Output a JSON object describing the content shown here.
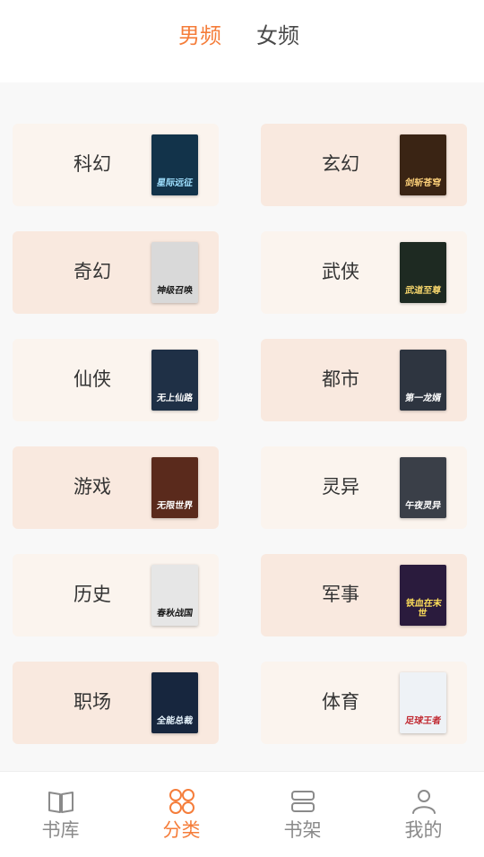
{
  "tabs": {
    "active": "男频",
    "inactive": "女频"
  },
  "categories": [
    {
      "label": "科幻",
      "cover_text": "星际远征",
      "cover_bg": "#12334a",
      "cover_fg": "#9fe0ff"
    },
    {
      "label": "玄幻",
      "cover_text": "剑斩苍穹",
      "cover_bg": "#3a2414",
      "cover_fg": "#ffd27a"
    },
    {
      "label": "奇幻",
      "cover_text": "神级召唤",
      "cover_bg": "#d9d9d9",
      "cover_fg": "#1b1b1b"
    },
    {
      "label": "武侠",
      "cover_text": "武道至尊",
      "cover_bg": "#1e2a22",
      "cover_fg": "#f3d36b"
    },
    {
      "label": "仙侠",
      "cover_text": "无上仙路",
      "cover_bg": "#1f3046",
      "cover_fg": "#ffffff"
    },
    {
      "label": "都市",
      "cover_text": "第一龙婿",
      "cover_bg": "#2e3540",
      "cover_fg": "#ffffff"
    },
    {
      "label": "游戏",
      "cover_text": "无限世界",
      "cover_bg": "#5a2a1c",
      "cover_fg": "#ffffff"
    },
    {
      "label": "灵异",
      "cover_text": "午夜灵异",
      "cover_bg": "#3a3f48",
      "cover_fg": "#ffffff"
    },
    {
      "label": "历史",
      "cover_text": "春秋战国",
      "cover_bg": "#e6e6e6",
      "cover_fg": "#1a1a1a"
    },
    {
      "label": "军事",
      "cover_text": "铁血在末世",
      "cover_bg": "#2a1b3d",
      "cover_fg": "#ffdf5a"
    },
    {
      "label": "职场",
      "cover_text": "全能总裁",
      "cover_bg": "#17263e",
      "cover_fg": "#e9f6ff"
    },
    {
      "label": "体育",
      "cover_text": "足球王者",
      "cover_bg": "#eef2f6",
      "cover_fg": "#c0262e"
    }
  ],
  "nav": [
    {
      "label": "书库",
      "icon": "book-open-icon",
      "active": false
    },
    {
      "label": "分类",
      "icon": "grid-circles-icon",
      "active": true
    },
    {
      "label": "书架",
      "icon": "bookshelf-icon",
      "active": false
    },
    {
      "label": "我的",
      "icon": "user-icon",
      "active": false
    }
  ],
  "colors": {
    "accent": "#f57d3a",
    "inactive_text": "#8a8a8a",
    "card_light": "#fbf4ee",
    "card_dark": "#f9e9df"
  }
}
